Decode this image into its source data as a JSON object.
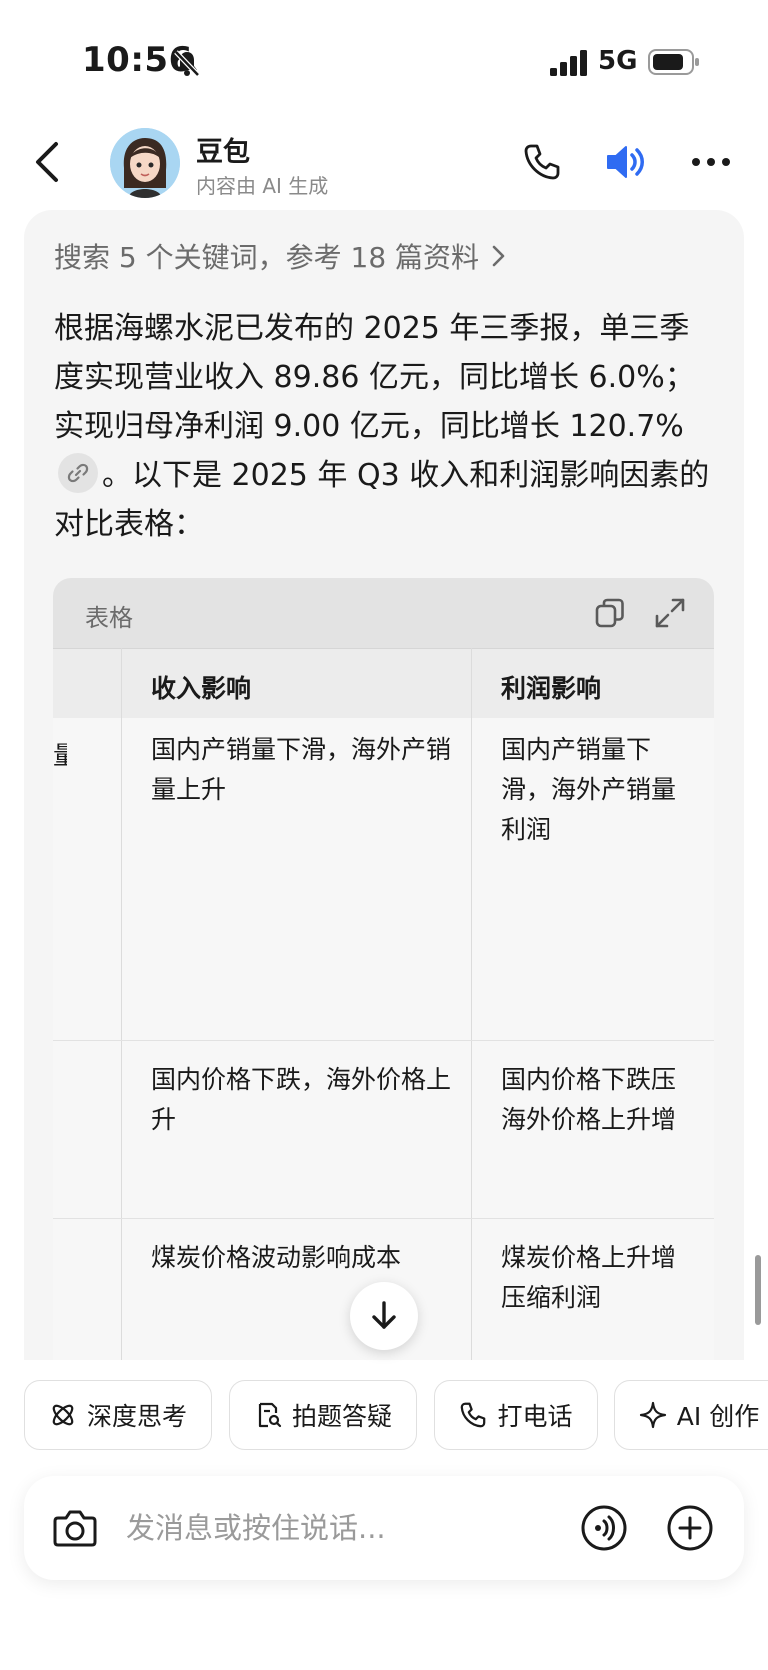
{
  "status_bar": {
    "time": "10:56",
    "network": "5G"
  },
  "header": {
    "name": "豆包",
    "subtitle": "内容由 AI 生成"
  },
  "search_summary": "搜索 5 个关键词，参考 18 篇资料",
  "answer": {
    "part1": "根据海螺水泥已发布的 2025 年三季报，单三季度实现营业收入 89.86 亿元，同比增长 6.0%；实现归母净利润 9.00 亿元，同比增长 120.7%",
    "part2": "。以下是 2025 年 Q3 收入和利润影响因素的对比表格："
  },
  "table": {
    "title": "表格",
    "headers": [
      "收入影响",
      "利润影响"
    ],
    "rows": [
      {
        "first": "量",
        "revenue": "国内产销量下滑，海外产销量上升",
        "profit": "国内产销量下滑，海外产销量利润"
      },
      {
        "first": "",
        "revenue": "国内价格下跌，海外价格上升",
        "profit": "国内价格下跌压海外价格上升增"
      },
      {
        "first": "",
        "revenue": "煤炭价格波动影响成本",
        "profit": "煤炭价格上升增压缩利润"
      }
    ]
  },
  "chips": [
    {
      "label": "深度思考",
      "icon": "atom-icon"
    },
    {
      "label": "拍题答疑",
      "icon": "scan-doc-icon"
    },
    {
      "label": "打电话",
      "icon": "phone-icon"
    },
    {
      "label": "AI 创作",
      "icon": "sparkle-icon"
    }
  ],
  "composer": {
    "placeholder": "发消息或按住说话..."
  }
}
